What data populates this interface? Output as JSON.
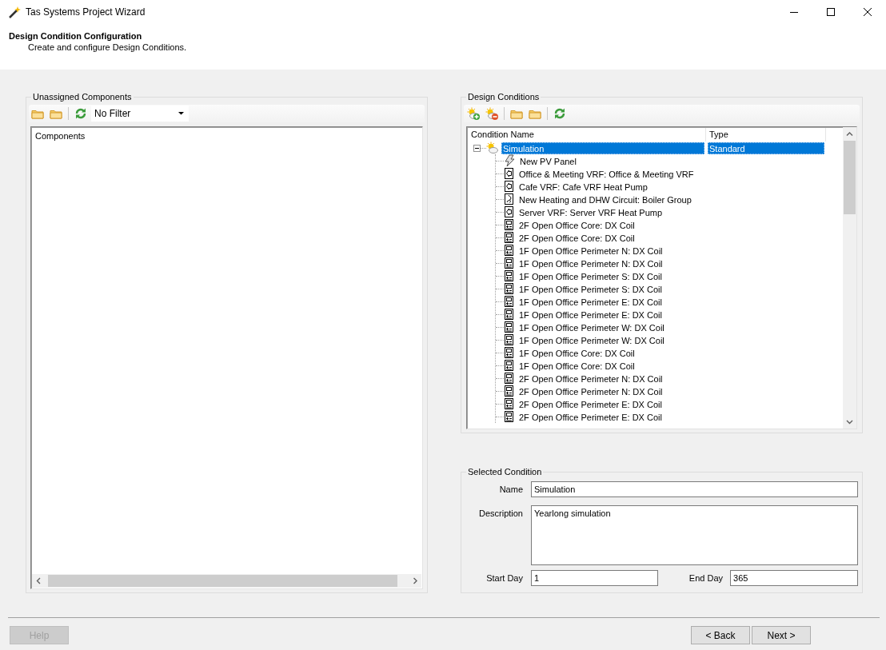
{
  "window": {
    "title": "Tas Systems Project Wizard"
  },
  "header": {
    "title": "Design Condition Configuration",
    "subtitle": "Create and configure Design Conditions."
  },
  "unassigned": {
    "title": "Unassigned Components",
    "filter": "No Filter",
    "tree_header": "Components"
  },
  "design_conditions": {
    "title": "Design Conditions",
    "columns": [
      "Condition Name",
      "Type"
    ],
    "rows": [
      {
        "name": "Simulation",
        "type": "Standard",
        "kind": "condition",
        "expanded": true,
        "selected": true,
        "children": [
          {
            "name": "New PV Panel",
            "kind": "pv",
            "selected": false
          },
          {
            "name": "Office & Meeting VRF: Office & Meeting VRF",
            "kind": "vrf",
            "selected": false
          },
          {
            "name": "Cafe VRF: Cafe VRF Heat Pump",
            "kind": "vrf",
            "selected": false
          },
          {
            "name": "New Heating and DHW Circuit: Boiler Group",
            "kind": "boiler",
            "selected": false
          },
          {
            "name": "Server VRF: Server VRF Heat Pump",
            "kind": "vrf",
            "selected": false
          },
          {
            "name": "2F Open Office Core: DX Coil",
            "kind": "dx",
            "selected": false
          },
          {
            "name": "2F Open Office Core: DX Coil",
            "kind": "dx",
            "selected": false
          },
          {
            "name": "1F Open Office Perimeter N: DX Coil",
            "kind": "dx",
            "selected": false
          },
          {
            "name": "1F Open Office Perimeter N: DX Coil",
            "kind": "dx",
            "selected": false
          },
          {
            "name": "1F Open Office Perimeter S: DX Coil",
            "kind": "dx",
            "selected": false
          },
          {
            "name": "1F Open Office Perimeter S: DX Coil",
            "kind": "dx",
            "selected": false
          },
          {
            "name": "1F Open Office Perimeter E: DX Coil",
            "kind": "dx",
            "selected": false
          },
          {
            "name": "1F Open Office Perimeter E: DX Coil",
            "kind": "dx",
            "selected": false
          },
          {
            "name": "1F Open Office Perimeter W: DX Coil",
            "kind": "dx",
            "selected": false
          },
          {
            "name": "1F Open Office Perimeter W: DX Coil",
            "kind": "dx",
            "selected": false
          },
          {
            "name": "1F Open Office Core: DX Coil",
            "kind": "dx",
            "selected": false
          },
          {
            "name": "1F Open Office Core: DX Coil",
            "kind": "dx",
            "selected": false
          },
          {
            "name": "2F Open Office Perimeter N: DX Coil",
            "kind": "dx",
            "selected": false
          },
          {
            "name": "2F Open Office Perimeter N: DX Coil",
            "kind": "dx",
            "selected": false
          },
          {
            "name": "2F Open Office Perimeter E: DX Coil",
            "kind": "dx",
            "selected": false
          },
          {
            "name": "2F Open Office Perimeter E: DX Coil",
            "kind": "dx",
            "selected": false
          }
        ]
      }
    ]
  },
  "selected_condition": {
    "title": "Selected Condition",
    "name": {
      "label": "Name",
      "value": "Simulation"
    },
    "description": {
      "label": "Description",
      "value": "Yearlong simulation"
    },
    "start_day": {
      "label": "Start Day",
      "value": "1"
    },
    "end_day": {
      "label": "End Day",
      "value": "365"
    }
  },
  "footer": {
    "help": {
      "label": "Help",
      "disabled": true
    },
    "nav": [
      {
        "label": "< Back",
        "disabled": false
      },
      {
        "label": "Next >",
        "disabled": false
      }
    ]
  }
}
